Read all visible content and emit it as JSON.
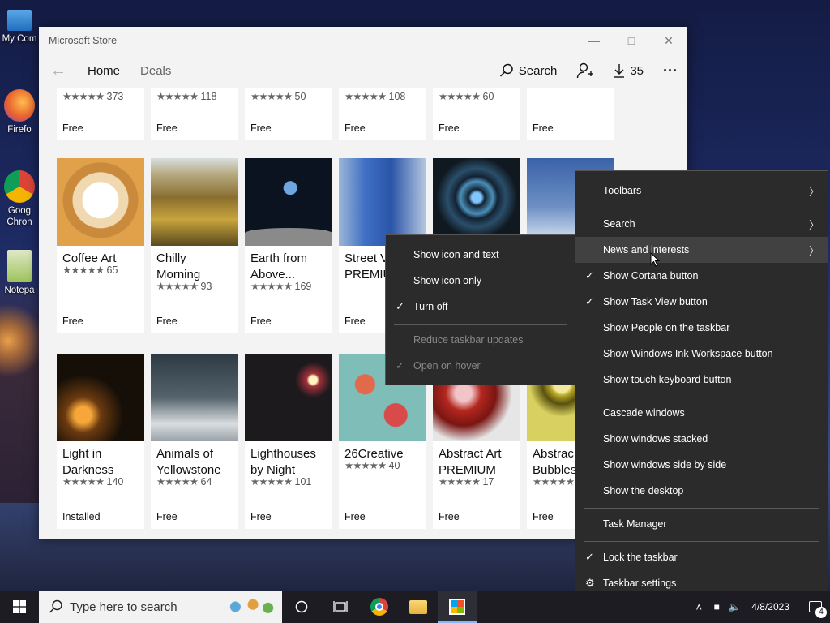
{
  "desktop": {
    "icons": [
      {
        "label": "My Com",
        "color": "#3b8fd6"
      },
      {
        "label": "Firefo",
        "color": "#e8632b"
      },
      {
        "label": "Goog Chron",
        "color": "#3c8f3c"
      },
      {
        "label": "Notepa",
        "color": "#9dc35a"
      }
    ]
  },
  "store": {
    "title": "Microsoft Store",
    "nav": {
      "back": "←",
      "tabs": [
        "Home",
        "Deals"
      ],
      "search_label": "Search",
      "downloads_count": "35",
      "more": "···"
    },
    "row1": [
      {
        "rating": "373",
        "price": "Free"
      },
      {
        "rating": "118",
        "price": "Free"
      },
      {
        "rating": "50",
        "price": "Free"
      },
      {
        "rating": "108",
        "price": "Free"
      },
      {
        "rating": "60",
        "price": "Free"
      },
      {
        "rating": "",
        "price": "Free"
      }
    ],
    "row2": [
      {
        "name": "Coffee Art",
        "rating": "65",
        "price": "Free",
        "color": "#d99a4a"
      },
      {
        "name": "Chilly Morning",
        "rating": "93",
        "price": "Free",
        "color": "#8a6e2f"
      },
      {
        "name": "Earth from Above...",
        "rating": "169",
        "price": "Free",
        "color": "#0b1220"
      },
      {
        "name": "Street V PREMIU",
        "rating": "",
        "price": "Free",
        "color": "#3f6fc4"
      },
      {
        "name": "",
        "rating": "",
        "price": "",
        "color": "#132232"
      },
      {
        "name": "",
        "rating": "",
        "price": "",
        "color": "#3a62a8"
      }
    ],
    "row3": [
      {
        "name": "Light in Darkness",
        "rating": "140",
        "price": "Installed",
        "color": "#150f08"
      },
      {
        "name": "Animals of Yellowstone",
        "rating": "64",
        "price": "Free",
        "color": "#3f4b55"
      },
      {
        "name": "Lighthouses by Night",
        "rating": "101",
        "price": "Free",
        "color": "#1d1a1e"
      },
      {
        "name": "26Creative",
        "rating": "40",
        "price": "Free",
        "color": "#7fbdb8"
      },
      {
        "name": "Abstract Art PREMIUM",
        "rating": "17",
        "price": "Free",
        "color": "#b3271f"
      },
      {
        "name": "Abstrac Bubbles",
        "rating": "",
        "price": "Free",
        "color": "#b8a828"
      }
    ],
    "stars": "★★★★★"
  },
  "taskbar_menu": {
    "items": [
      {
        "label": "Toolbars",
        "arrow": "〉",
        "checked": false
      },
      {
        "label": "Search",
        "arrow": "〉",
        "checked": false
      },
      {
        "label": "News and interests",
        "arrow": "〉",
        "checked": false
      },
      {
        "label": "Show Cortana button",
        "checked": true
      },
      {
        "label": "Show Task View button",
        "checked": true
      },
      {
        "label": "Show People on the taskbar",
        "checked": false
      },
      {
        "label": "Show Windows Ink Workspace button",
        "checked": false
      },
      {
        "label": "Show touch keyboard button",
        "checked": false
      },
      {
        "label": "Cascade windows",
        "checked": false
      },
      {
        "label": "Show windows stacked",
        "checked": false
      },
      {
        "label": "Show windows side by side",
        "checked": false
      },
      {
        "label": "Show the desktop",
        "checked": false
      },
      {
        "label": "Task Manager",
        "checked": false
      },
      {
        "label": "Lock the taskbar",
        "checked": true
      },
      {
        "label": "Taskbar settings",
        "checked": false
      }
    ],
    "check_glyph": "✓",
    "gear_glyph": "⚙"
  },
  "news_menu": {
    "items": [
      {
        "label": "Show icon and text",
        "checked": false
      },
      {
        "label": "Show icon only",
        "checked": false
      },
      {
        "label": "Turn off",
        "checked": true
      },
      {
        "label": "Reduce taskbar updates",
        "disabled": true
      },
      {
        "label": "Open on hover",
        "checked": true,
        "disabled": true
      }
    ]
  },
  "taskbar": {
    "search_placeholder": "Type here to search",
    "date": "4/8/2023",
    "notifications": "4"
  }
}
